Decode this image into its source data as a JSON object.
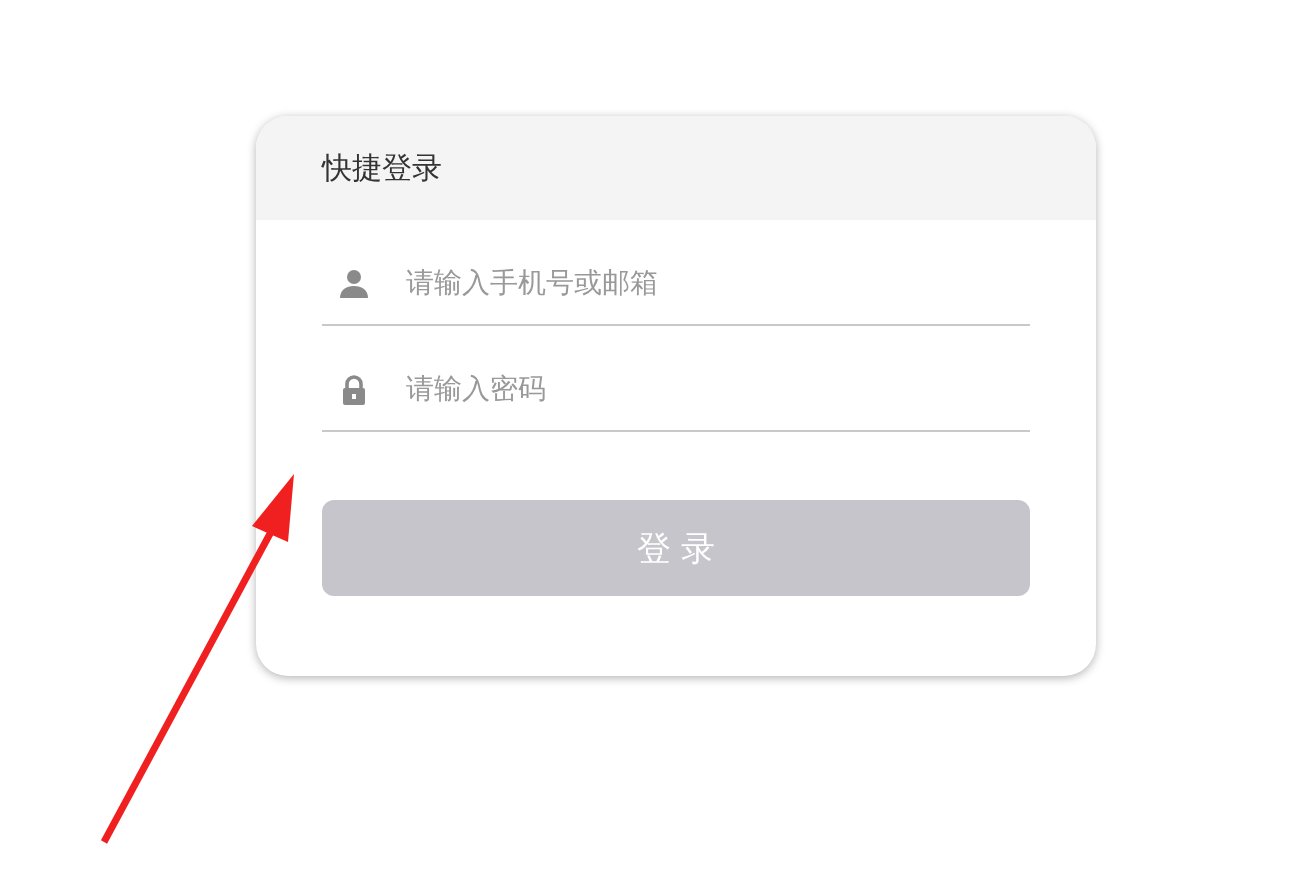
{
  "login_card": {
    "title": "快捷登录",
    "fields": [
      {
        "kind": "user",
        "placeholder": "请输入手机号或邮箱"
      },
      {
        "kind": "password",
        "placeholder": "请输入密码"
      }
    ],
    "submit": {
      "label": "登 录",
      "disabled": true
    }
  }
}
